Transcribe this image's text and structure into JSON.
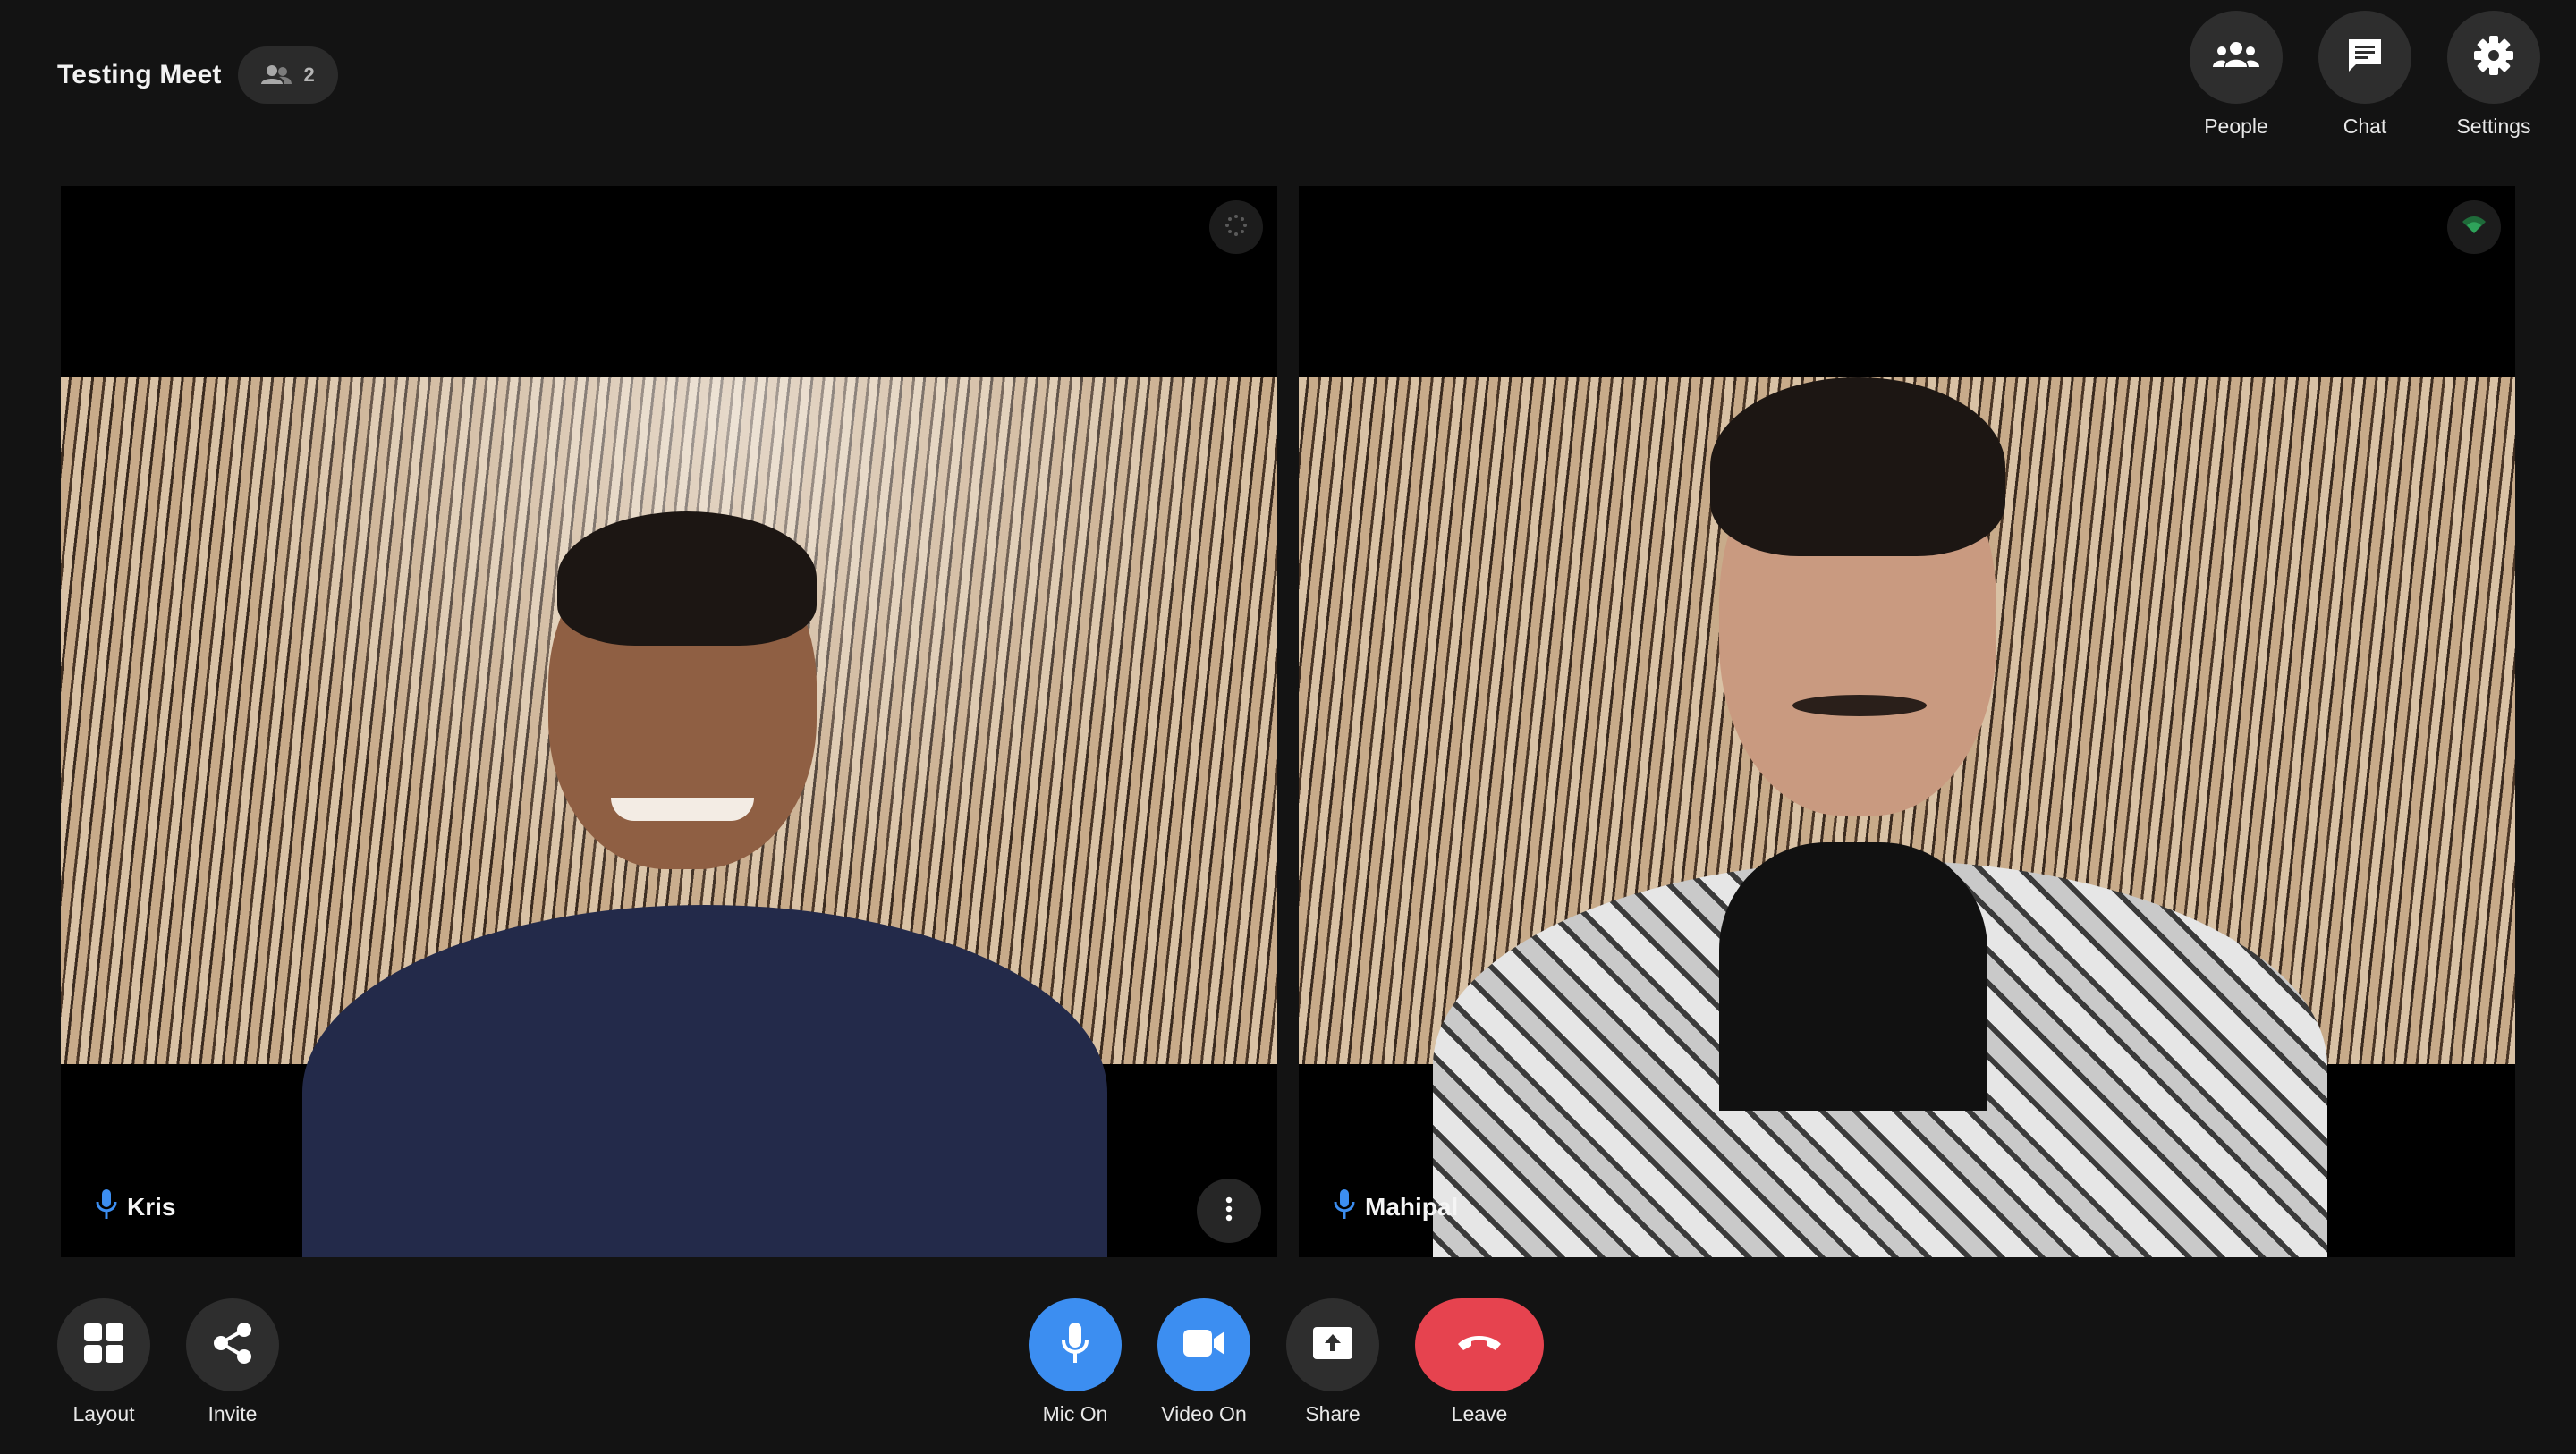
{
  "header": {
    "meeting_title": "Testing Meet",
    "participant_count": "2",
    "actions": [
      {
        "label": "People",
        "icon": "people-icon"
      },
      {
        "label": "Chat",
        "icon": "chat-icon"
      },
      {
        "label": "Settings",
        "icon": "gear-icon"
      }
    ]
  },
  "tiles": [
    {
      "name": "Kris",
      "mic_icon": "mic-icon",
      "status_icon": "loading-spinner-icon",
      "has_menu": true
    },
    {
      "name": "Mahipal",
      "mic_icon": "mic-icon",
      "status_icon": "wifi-signal-icon",
      "has_menu": false
    }
  ],
  "bottom_left": [
    {
      "label": "Layout",
      "icon": "grid-icon"
    },
    {
      "label": "Invite",
      "icon": "share-nodes-icon"
    }
  ],
  "controls": [
    {
      "label": "Mic On",
      "icon": "mic-icon",
      "active": true
    },
    {
      "label": "Video On",
      "icon": "camera-icon",
      "active": true
    },
    {
      "label": "Share",
      "icon": "screen-share-icon",
      "active": false
    },
    {
      "label": "Leave",
      "icon": "hang-up-icon",
      "active": false
    }
  ],
  "colors": {
    "background": "#131313",
    "surface": "#2e2e2e",
    "accent_blue": "#3c8ef1",
    "leave_red": "#e6434f",
    "mic_blue": "#3c8ef1"
  }
}
